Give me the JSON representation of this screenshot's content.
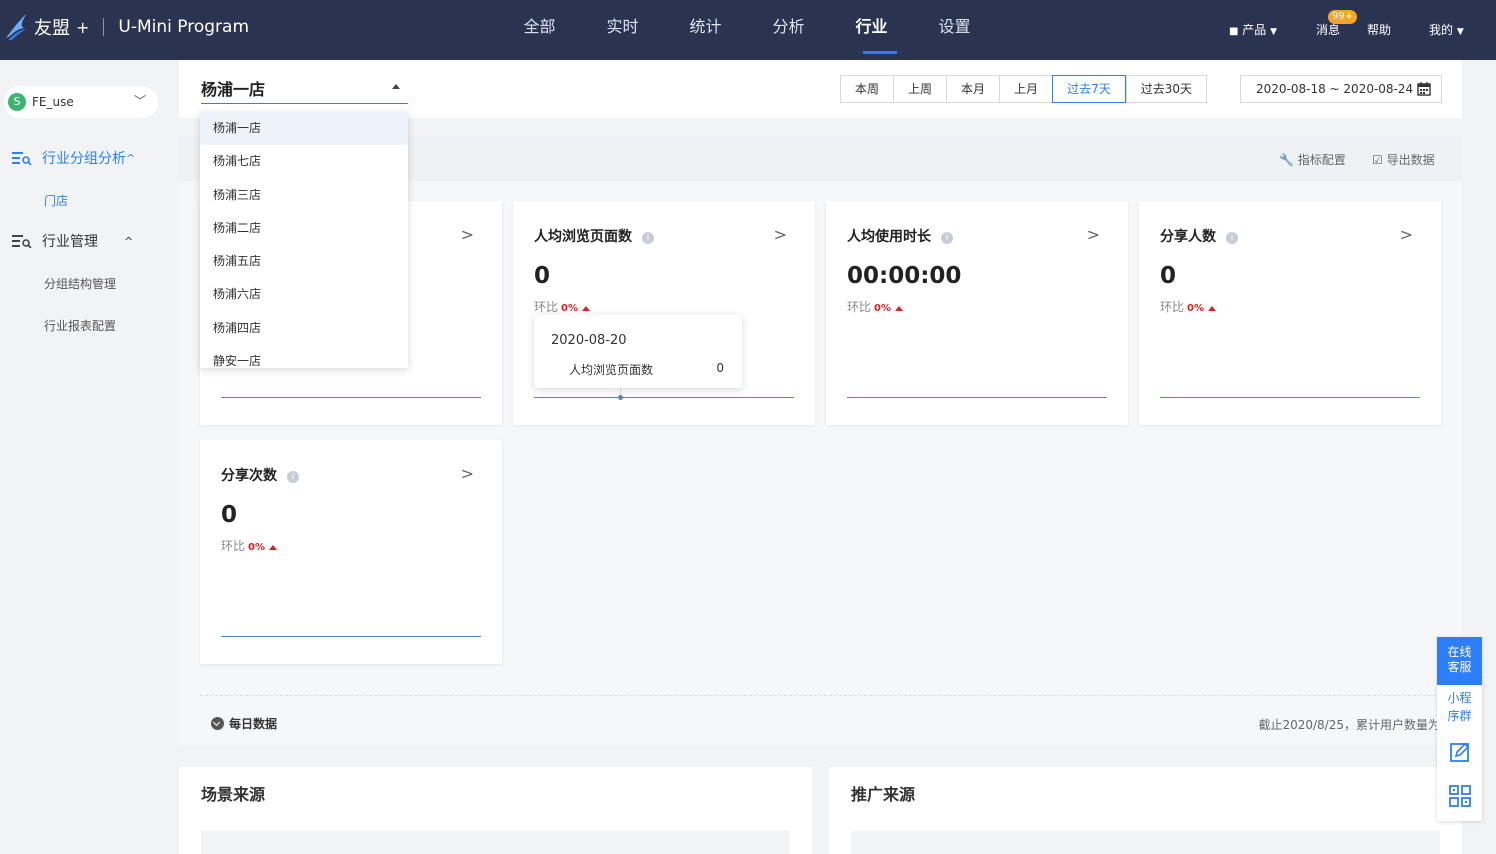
{
  "brand": {
    "name": "友盟",
    "plus": "+",
    "product": "U-Mini Program"
  },
  "nav": {
    "items": [
      "全部",
      "实时",
      "统计",
      "分析",
      "行业",
      "设置"
    ],
    "active": "行业"
  },
  "topright": {
    "products": "产品",
    "messages": "消息",
    "badge": "99+",
    "help": "帮助",
    "mine": "我的"
  },
  "sidebar": {
    "app": "FE_use",
    "group1": {
      "label": "行业分组分析",
      "items": [
        "门店"
      ]
    },
    "group2": {
      "label": "行业管理",
      "items": [
        "分组结构管理",
        "行业报表配置"
      ]
    }
  },
  "filter": {
    "store": "杨浦一店",
    "ranges": [
      "本周",
      "上周",
      "本月",
      "上月",
      "过去7天",
      "过去30天"
    ],
    "active_range": "过去7天",
    "daterange": "2020-08-18 ~ 2020-08-24"
  },
  "dropdown": {
    "options": [
      "杨浦一店",
      "杨浦七店",
      "杨浦三店",
      "杨浦二店",
      "杨浦五店",
      "杨浦六店",
      "杨浦四店",
      "静安一店"
    ]
  },
  "panel": {
    "metric_config": "指标配置",
    "export": "导出数据",
    "daily": "每日数据",
    "cumulative": "截止2020/8/25，累计用户数量为"
  },
  "cards": [
    {
      "title": "人均浏览页面数",
      "value": "0",
      "compare": "环比",
      "pct": "0%"
    },
    {
      "title": "人均使用时长",
      "value": "00:00:00",
      "compare": "环比",
      "pct": "0%"
    },
    {
      "title": "分享人数",
      "value": "0",
      "compare": "环比",
      "pct": "0%"
    },
    {
      "title": "分享次数",
      "value": "0",
      "compare": "环比",
      "pct": "0%"
    }
  ],
  "tooltip": {
    "date": "2020-08-20",
    "label": "人均浏览页面数",
    "value": "0"
  },
  "sections": {
    "scene": "场景来源",
    "promo": "推广来源"
  },
  "floatbar": {
    "service": "在线客服",
    "mini": "小程序群"
  },
  "colors": {
    "topbar": "#2a3451",
    "accent": "#2d7ff9",
    "up": "#e02020"
  }
}
